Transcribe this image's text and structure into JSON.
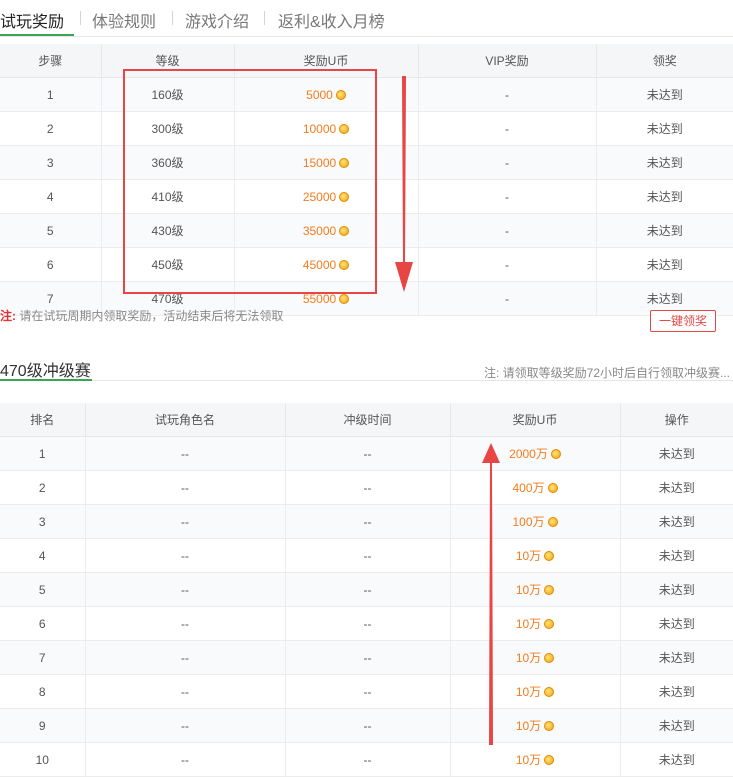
{
  "tabs": [
    {
      "label": "试玩奖励",
      "active": true
    },
    {
      "label": "体验规则",
      "active": false
    },
    {
      "label": "游戏介绍",
      "active": false
    },
    {
      "label": "返利&收入月榜",
      "active": false
    }
  ],
  "reward_table": {
    "headers": [
      "步骤",
      "等级",
      "奖励U币",
      "VIP奖励",
      "领奖"
    ],
    "rows": [
      {
        "step": "1",
        "level": "160级",
        "coins": "5000",
        "vip": "-",
        "status": "未达到"
      },
      {
        "step": "2",
        "level": "300级",
        "coins": "10000",
        "vip": "-",
        "status": "未达到"
      },
      {
        "step": "3",
        "level": "360级",
        "coins": "15000",
        "vip": "-",
        "status": "未达到"
      },
      {
        "step": "4",
        "level": "410级",
        "coins": "25000",
        "vip": "-",
        "status": "未达到"
      },
      {
        "step": "5",
        "level": "430级",
        "coins": "35000",
        "vip": "-",
        "status": "未达到"
      },
      {
        "step": "6",
        "level": "450级",
        "coins": "45000",
        "vip": "-",
        "status": "未达到"
      },
      {
        "step": "7",
        "level": "470级",
        "coins": "55000",
        "vip": "-",
        "status": "未达到"
      }
    ]
  },
  "reward_note": {
    "label": "注:",
    "text": " 请在试玩周期内领取奖励，活动结束后将无法领取"
  },
  "claim_all_button": "一键领奖",
  "race_section": {
    "title": "470级冲级赛",
    "note": "注: 请领取等级奖励72小时后自行领取冲级赛..."
  },
  "race_table": {
    "headers": [
      "排名",
      "试玩角色名",
      "冲级时间",
      "奖励U币",
      "操作"
    ],
    "rows": [
      {
        "rank": "1",
        "name": "--",
        "time": "--",
        "coins": "2000万",
        "status": "未达到"
      },
      {
        "rank": "2",
        "name": "--",
        "time": "--",
        "coins": "400万",
        "status": "未达到"
      },
      {
        "rank": "3",
        "name": "--",
        "time": "--",
        "coins": "100万",
        "status": "未达到"
      },
      {
        "rank": "4",
        "name": "--",
        "time": "--",
        "coins": "10万",
        "status": "未达到"
      },
      {
        "rank": "5",
        "name": "--",
        "time": "--",
        "coins": "10万",
        "status": "未达到"
      },
      {
        "rank": "6",
        "name": "--",
        "time": "--",
        "coins": "10万",
        "status": "未达到"
      },
      {
        "rank": "7",
        "name": "--",
        "time": "--",
        "coins": "10万",
        "status": "未达到"
      },
      {
        "rank": "8",
        "name": "--",
        "time": "--",
        "coins": "10万",
        "status": "未达到"
      },
      {
        "rank": "9",
        "name": "--",
        "time": "--",
        "coins": "10万",
        "status": "未达到"
      },
      {
        "rank": "10",
        "name": "--",
        "time": "--",
        "coins": "10万",
        "status": "未达到"
      }
    ]
  },
  "colors": {
    "accent": "#3aa655",
    "coin": "#f47c1d",
    "annotation": "#e84545"
  },
  "icons": {
    "coin": "coin-icon"
  }
}
